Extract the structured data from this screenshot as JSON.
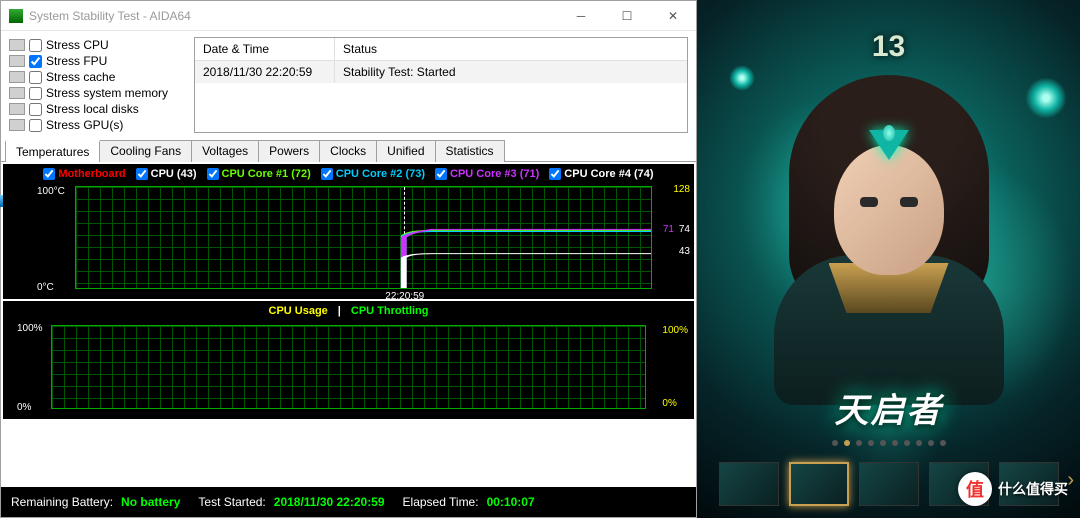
{
  "window": {
    "title": "System Stability Test - AIDA64"
  },
  "stress_options": [
    {
      "label": "Stress CPU",
      "checked": false
    },
    {
      "label": "Stress FPU",
      "checked": true
    },
    {
      "label": "Stress cache",
      "checked": false
    },
    {
      "label": "Stress system memory",
      "checked": false
    },
    {
      "label": "Stress local disks",
      "checked": false
    },
    {
      "label": "Stress GPU(s)",
      "checked": false
    }
  ],
  "log_table": {
    "headers": [
      "Date & Time",
      "Status"
    ],
    "rows": [
      [
        "2018/11/30 22:20:59",
        "Stability Test: Started"
      ]
    ]
  },
  "tabs": [
    "Temperatures",
    "Cooling Fans",
    "Voltages",
    "Powers",
    "Clocks",
    "Unified",
    "Statistics"
  ],
  "active_tab": 0,
  "chart_data": [
    {
      "type": "line",
      "title": "Temperatures",
      "ylabel": "°C",
      "ylim": [
        0,
        100
      ],
      "right_max": 128,
      "time_marker": "22:20:59",
      "series": [
        {
          "name": "Motherboard",
          "color": "#ff0000",
          "checked": true,
          "latest": null
        },
        {
          "name": "CPU",
          "color": "#ffffff",
          "checked": true,
          "latest": 43
        },
        {
          "name": "CPU Core #1",
          "color": "#66ff00",
          "checked": true,
          "latest": 72
        },
        {
          "name": "CPU Core #2",
          "color": "#00ccff",
          "checked": true,
          "latest": 73
        },
        {
          "name": "CPU Core #3",
          "color": "#cc33ff",
          "checked": true,
          "latest": 71
        },
        {
          "name": "CPU Core #4",
          "color": "#ffffff",
          "checked": true,
          "latest": 74
        }
      ],
      "right_labels": [
        {
          "text": "128",
          "color": "#ffff00",
          "pct_from_top": 0
        },
        {
          "text": "74",
          "color": "#ffffff",
          "pct_from_top": 42
        },
        {
          "text": "71",
          "color": "#cc33ff",
          "pct_from_top": 44
        },
        {
          "text": "43",
          "color": "#ffffff",
          "pct_from_top": 66
        }
      ],
      "step_profile": {
        "rise_at_pct": 57,
        "plateau_pct_from_top": 43,
        "cpu_pct_from_top": 66
      }
    },
    {
      "type": "line",
      "title_left": "CPU Usage",
      "title_right": "CPU Throttling",
      "ylim": [
        0,
        100
      ],
      "left_axis": [
        "100%",
        "0%"
      ],
      "right_axis": [
        "100%",
        "0%"
      ],
      "series": [
        {
          "name": "CPU Usage",
          "color": "#ffff00",
          "value_pct": 0
        },
        {
          "name": "CPU Throttling",
          "color": "#00ff00",
          "value_pct": 0
        }
      ]
    }
  ],
  "status_bar": {
    "battery_label": "Remaining Battery:",
    "battery_value": "No battery",
    "started_label": "Test Started:",
    "started_value": "2018/11/30 22:20:59",
    "elapsed_label": "Elapsed Time:",
    "elapsed_value": "00:10:07"
  },
  "game": {
    "slot_number": "13",
    "skin_title": "天启者",
    "dots_total": 10,
    "dots_active": 1,
    "watermark_badge": "值",
    "watermark_text": "什么值得买"
  }
}
